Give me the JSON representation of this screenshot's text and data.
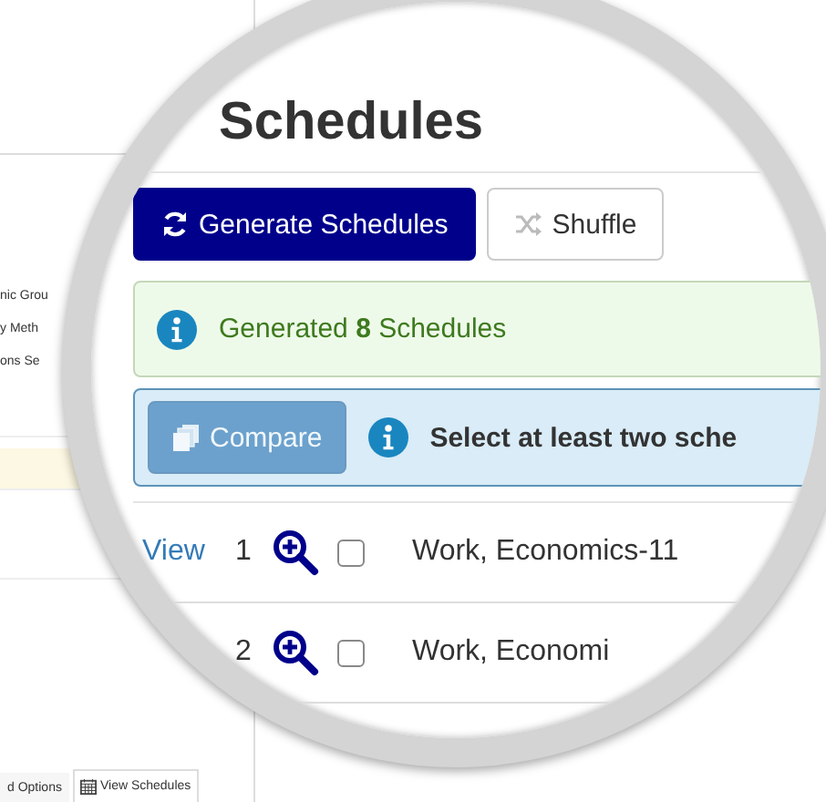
{
  "background": {
    "panel_items": [
      "nic Grou",
      "y Meth",
      "ons Se"
    ],
    "tabs": [
      {
        "label": "d Options",
        "selected": false
      },
      {
        "label": "View Schedules",
        "selected": true
      }
    ]
  },
  "lens": {
    "title": "Schedules",
    "buttons": [
      {
        "label": "Generate Schedules",
        "kind": "primary"
      },
      {
        "label": "Shuffle",
        "kind": "secondary"
      }
    ],
    "success_alert": "Generated **8** Schedules",
    "compare": {
      "button": "Compare",
      "disabled": true,
      "message": "Select at least two sche"
    },
    "rows": [
      {
        "view": "View",
        "number": "1",
        "checked": false,
        "text": "Work, Economics-11"
      },
      {
        "number": "2",
        "checked": false,
        "text": "Work, Economi"
      }
    ]
  }
}
